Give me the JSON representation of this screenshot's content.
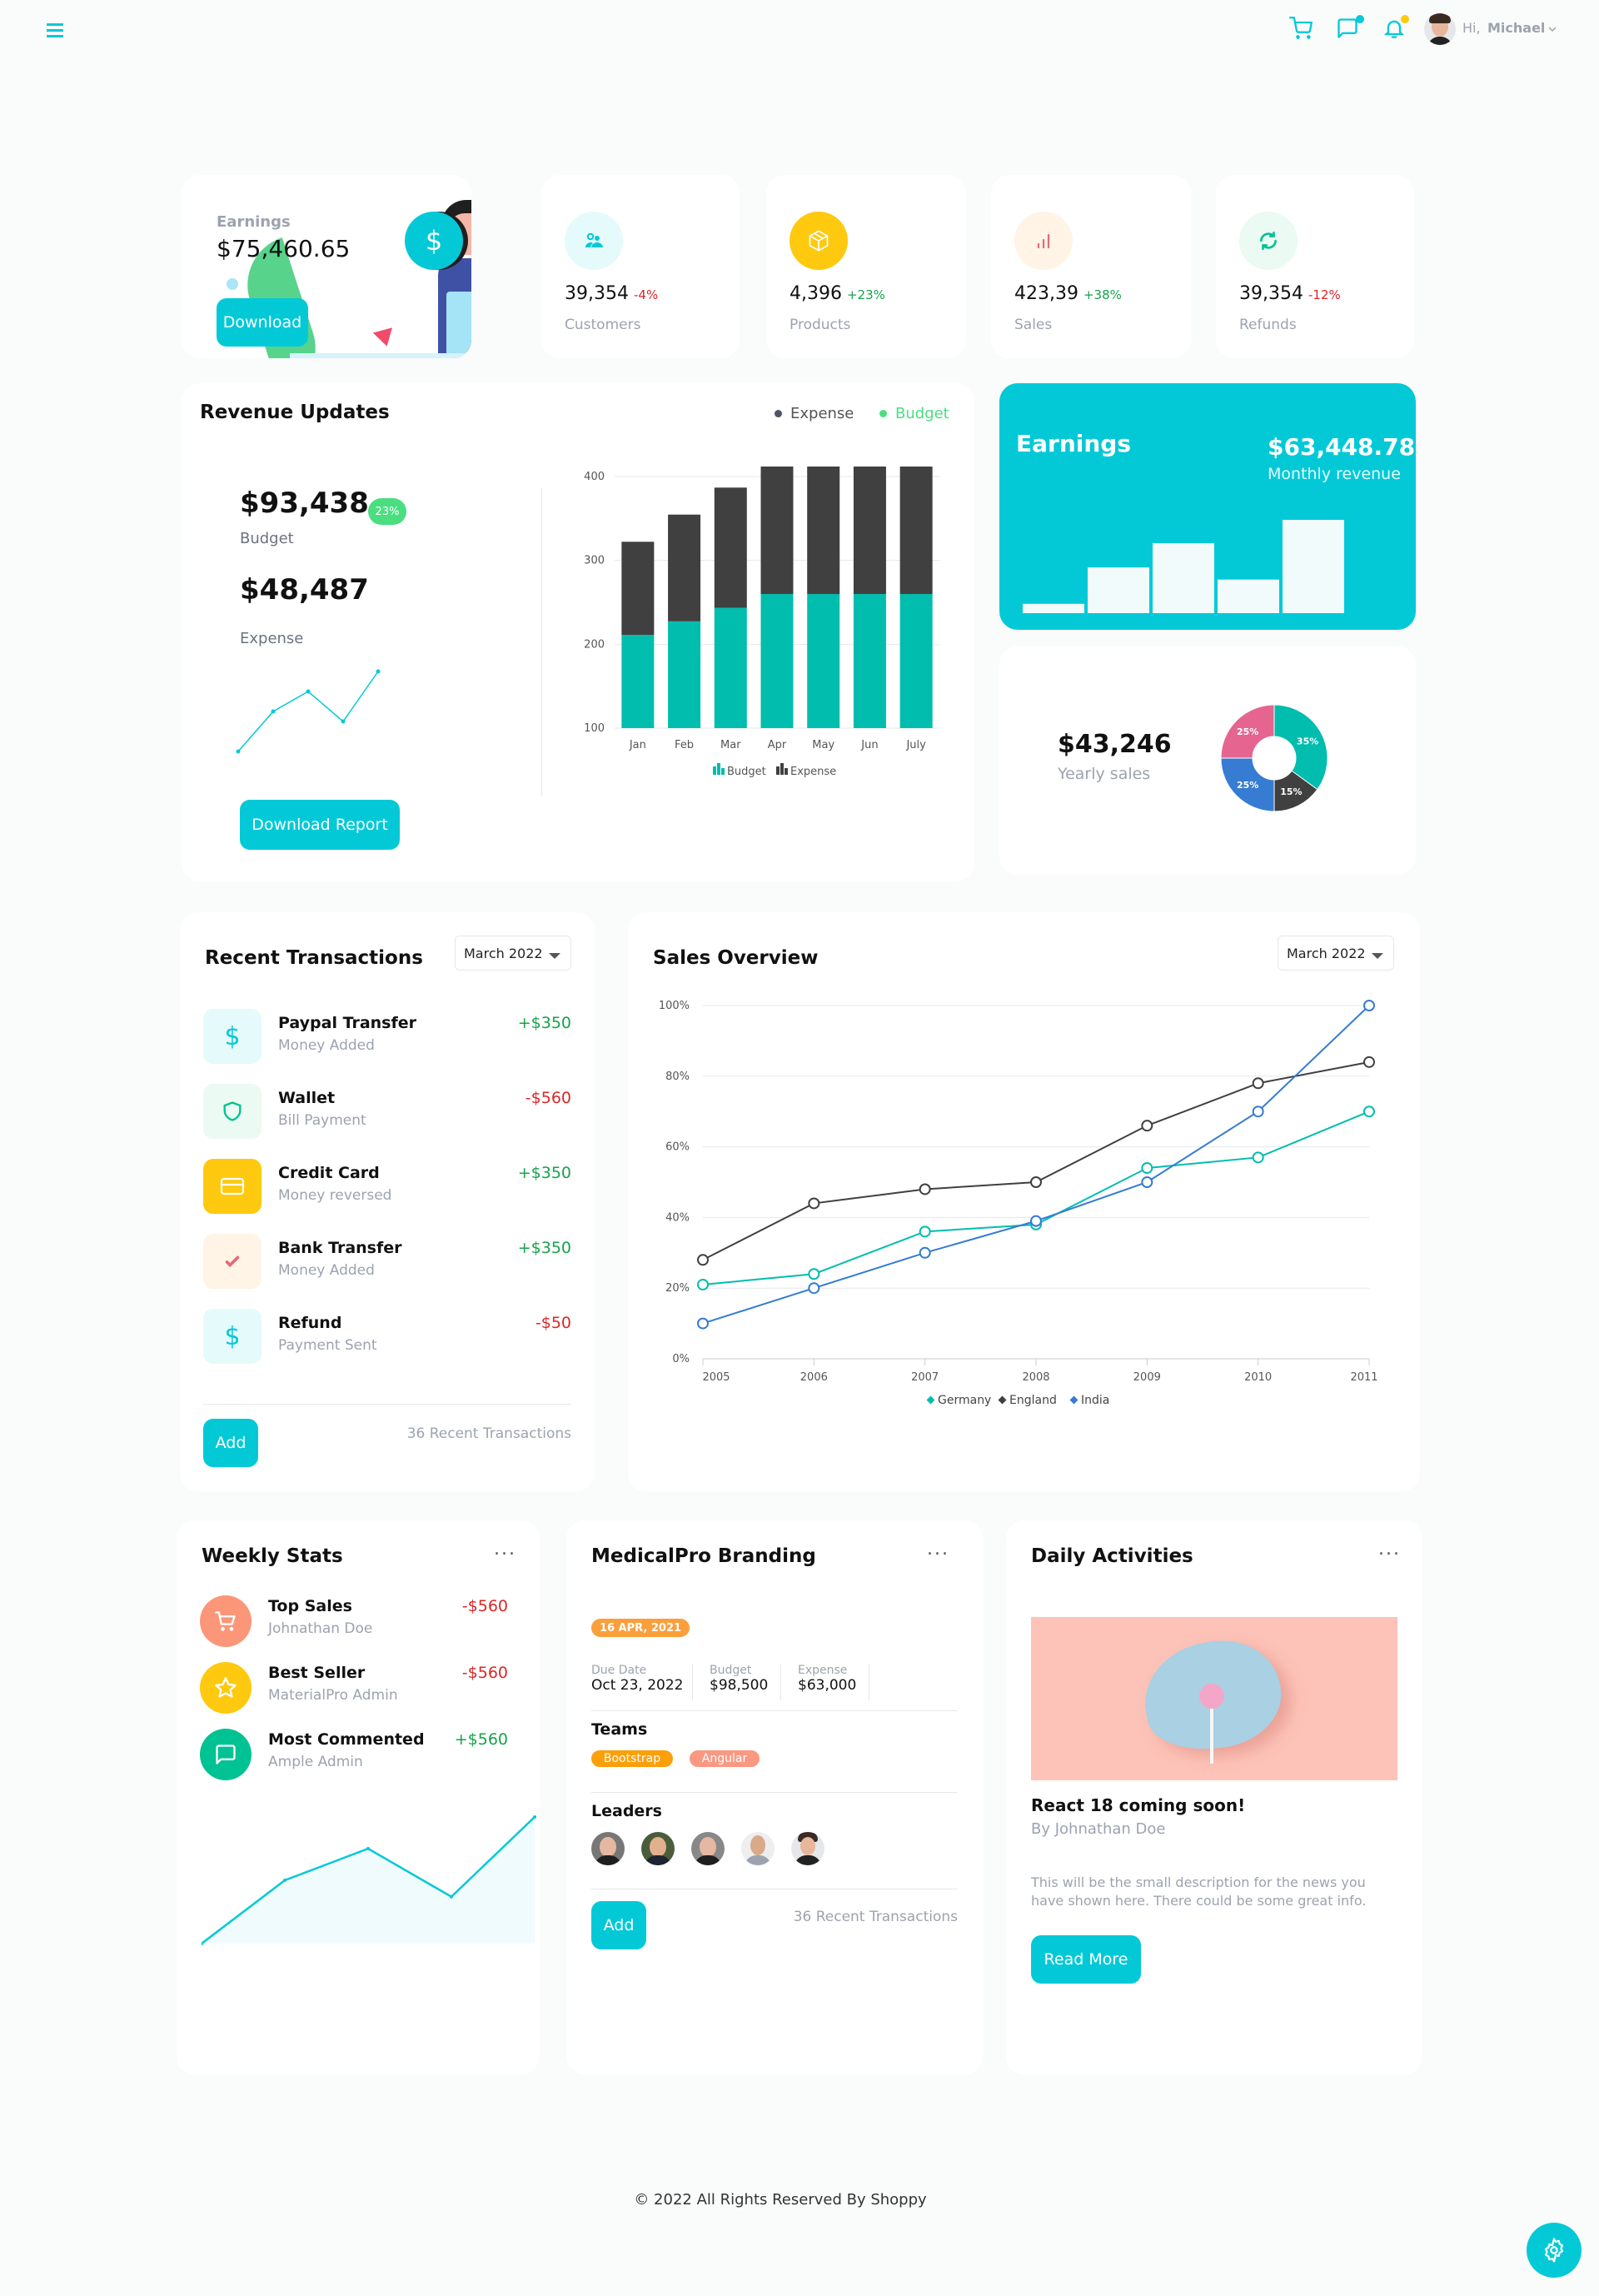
{
  "navbar": {
    "menu_icon": "hamburger-icon",
    "cart_icon": "cart-icon",
    "chat_icon": "chat-icon",
    "notification_icon": "bell-icon",
    "greeting": "Hi,",
    "user_name": "Michael",
    "chevron_icon": "chevron-down-icon"
  },
  "hero": {
    "label": "Earnings",
    "value": "$75,460.65",
    "button": "Download",
    "icon": "dollar-icon"
  },
  "stats": [
    {
      "value": "39,354",
      "change": "-4%",
      "trend": "down",
      "label": "Customers",
      "icon": "customers-icon",
      "icon_color": "#03c9d7",
      "icon_bg": "#e5fafb"
    },
    {
      "value": "4,396",
      "change": "+23%",
      "trend": "up",
      "label": "Products",
      "icon": "box-icon",
      "icon_color": "#ffffff",
      "icon_bg": "#fec90f"
    },
    {
      "value": "423,39",
      "change": "+38%",
      "trend": "up",
      "label": "Sales",
      "icon": "bar-chart-icon",
      "icon_color": "#e46a76",
      "icon_bg": "#fff4e5"
    },
    {
      "value": "39,354",
      "change": "-12%",
      "trend": "down",
      "label": "Refunds",
      "icon": "refresh-icon",
      "icon_color": "#00c292",
      "icon_bg": "#ebfaf2"
    }
  ],
  "revenue": {
    "title": "Revenue Updates",
    "legend_expense": "Expense",
    "legend_budget": "Budget",
    "budget_value": "$93,438",
    "budget_badge": "23%",
    "budget_label": "Budget",
    "expense_value": "$48,487",
    "expense_label": "Expense",
    "download_button": "Download Report"
  },
  "earnings_card": {
    "title": "Earnings",
    "value": "$63,448.78",
    "subtitle": "Monthly revenue"
  },
  "yearly": {
    "value": "$43,246",
    "label": "Yearly sales"
  },
  "transactions": {
    "title": "Recent Transactions",
    "dropdown": "March 2022",
    "items": [
      {
        "name": "Paypal Transfer",
        "sub": "Money Added",
        "amount": "+$350",
        "trend": "up",
        "icon": "dollar-icon"
      },
      {
        "name": "Wallet",
        "sub": "Bill Payment",
        "amount": "-$560",
        "trend": "down",
        "icon": "shield-icon"
      },
      {
        "name": "Credit Card",
        "sub": "Money reversed",
        "amount": "+$350",
        "trend": "up",
        "icon": "credit-card-icon"
      },
      {
        "name": "Bank Transfer",
        "sub": "Money Added",
        "amount": "+$350",
        "trend": "up",
        "icon": "check-icon"
      },
      {
        "name": "Refund",
        "sub": "Payment Sent",
        "amount": "-$50",
        "trend": "down",
        "icon": "dollar-icon"
      }
    ],
    "add_button": "Add",
    "footer_text": "36 Recent Transactions"
  },
  "sales_overview": {
    "title": "Sales Overview",
    "dropdown": "March 2022"
  },
  "weekly": {
    "title": "Weekly Stats",
    "menu": "...",
    "items": [
      {
        "name": "Top Sales",
        "sub": "Johnathan Doe",
        "amount": "-$560",
        "trend": "down",
        "icon": "cart-icon",
        "color": "#fb9678"
      },
      {
        "name": "Best Seller",
        "sub": "MaterialPro Admin",
        "amount": "-$560",
        "trend": "down",
        "icon": "star-icon",
        "color": "#fec90f"
      },
      {
        "name": "Most Commented",
        "sub": "Ample Admin",
        "amount": "+$560",
        "trend": "up",
        "icon": "comment-icon",
        "color": "#00c292"
      }
    ]
  },
  "branding": {
    "title": "MedicalPro Branding",
    "menu": "...",
    "date_badge": "16 APR, 2021",
    "due_label": "Due Date",
    "due_value": "Oct 23, 2022",
    "budget_label": "Budget",
    "budget_value": "$98,500",
    "expense_label": "Expense",
    "expense_value": "$63,000",
    "teams_label": "Teams",
    "teams": [
      {
        "name": "Bootstrap",
        "color": "#fb9f0a"
      },
      {
        "name": "Angular",
        "color": "#fa9882"
      }
    ],
    "leaders_label": "Leaders",
    "leaders_count": 5,
    "add_button": "Add",
    "footer_text": "36 Recent Transactions"
  },
  "daily": {
    "title": "Daily Activities",
    "menu": "...",
    "image": "lollipop-on-plate-image",
    "headline": "React 18 coming soon!",
    "author": "By Johnathan Doe",
    "description": "This will be the small description for the news you have shown here. There could be some great info.",
    "button": "Read More"
  },
  "footer": {
    "text": "© 2022 All Rights Reserved By Shoppy"
  },
  "settings_fab": {
    "icon": "gear-icon"
  },
  "colors": {
    "accent": "#03c9d7",
    "dark": "#404041",
    "teal_bar": "#00bdae",
    "green_badge": "#4ade80",
    "pink": "#e56590",
    "blue": "#357cd2"
  },
  "chart_data": [
    {
      "id": "revenue-stacked-bar",
      "type": "bar",
      "stacked": true,
      "categories": [
        "Jan",
        "Feb",
        "Mar",
        "Apr",
        "May",
        "Jun",
        "July"
      ],
      "series": [
        {
          "name": "Budget",
          "color": "#00bdae",
          "values": [
            111.1,
            127.3,
            143.4,
            159.9,
            159.9,
            159.9,
            159.9
          ]
        },
        {
          "name": "Expense",
          "color": "#404041",
          "values": [
            111.1,
            127.3,
            143.4,
            159.9,
            159.9,
            159.9,
            159.9
          ]
        }
      ],
      "ylim": [
        100,
        400
      ],
      "yticks": [
        "100",
        "200",
        "300",
        "400"
      ],
      "legend": "bottom",
      "grid": true
    },
    {
      "id": "revenue-sparkline",
      "type": "line",
      "values": [
        2,
        6,
        8,
        5,
        10
      ]
    },
    {
      "id": "earnings-bars",
      "type": "bar",
      "values": [
        10,
        49,
        75,
        36,
        100
      ]
    },
    {
      "id": "yearly-donut",
      "type": "pie",
      "slices": [
        {
          "label": "35%",
          "value": 35,
          "color": "#00bdae"
        },
        {
          "label": "15%",
          "value": 15,
          "color": "#404041"
        },
        {
          "label": "25%",
          "value": 25,
          "color": "#357cd2"
        },
        {
          "label": "25%",
          "value": 25,
          "color": "#e56590"
        }
      ]
    },
    {
      "id": "sales-overview-line",
      "type": "line",
      "x": [
        "2005",
        "2006",
        "2007",
        "2008",
        "2009",
        "2010",
        "2011"
      ],
      "series": [
        {
          "name": "Germany",
          "color": "#00bdae",
          "values": [
            21,
            24,
            36,
            38,
            54,
            57,
            70
          ]
        },
        {
          "name": "England",
          "color": "#404041",
          "values": [
            28,
            44,
            48,
            50,
            66,
            78,
            84
          ]
        },
        {
          "name": "India",
          "color": "#357cd2",
          "values": [
            10,
            20,
            30,
            39,
            50,
            70,
            100
          ]
        }
      ],
      "ylim": [
        0,
        100
      ],
      "yticks": [
        "0%",
        "20%",
        "40%",
        "60%",
        "80%",
        "100%"
      ],
      "legend": "bottom",
      "grid": true
    },
    {
      "id": "weekly-area",
      "type": "area",
      "values": [
        0,
        50,
        75,
        37,
        100
      ]
    }
  ]
}
